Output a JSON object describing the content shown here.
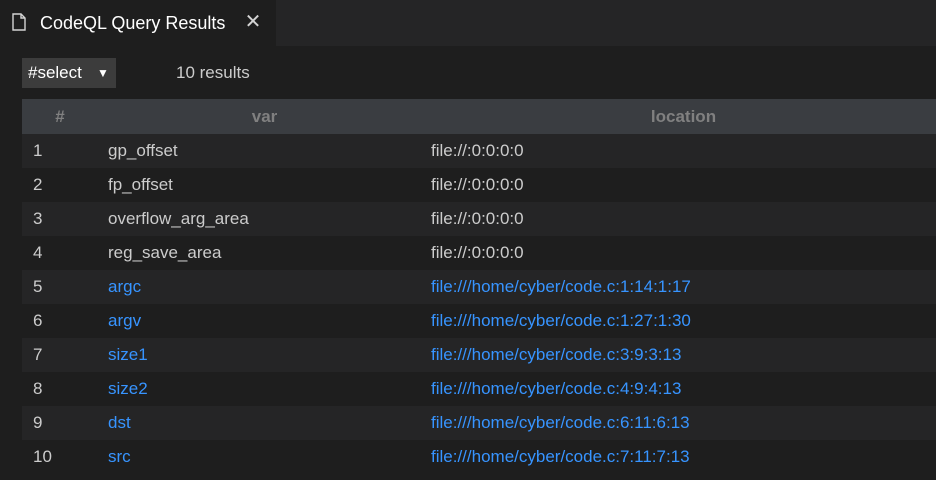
{
  "tab": {
    "title": "CodeQL Query Results",
    "icon": "file-icon",
    "close_icon": "close-icon",
    "close_glyph": "✕"
  },
  "toolbar": {
    "select_label": "#select",
    "select_caret": "▼",
    "result_count": "10 results"
  },
  "table": {
    "headers": [
      "#",
      "var",
      "location"
    ],
    "rows": [
      {
        "num": "1",
        "var": "gp_offset",
        "location": "file://:0:0:0:0",
        "linked": false
      },
      {
        "num": "2",
        "var": "fp_offset",
        "location": "file://:0:0:0:0",
        "linked": false
      },
      {
        "num": "3",
        "var": "overflow_arg_area",
        "location": "file://:0:0:0:0",
        "linked": false
      },
      {
        "num": "4",
        "var": "reg_save_area",
        "location": "file://:0:0:0:0",
        "linked": false
      },
      {
        "num": "5",
        "var": "argc",
        "location": "file:///home/cyber/code.c:1:14:1:17",
        "linked": true
      },
      {
        "num": "6",
        "var": "argv",
        "location": "file:///home/cyber/code.c:1:27:1:30",
        "linked": true
      },
      {
        "num": "7",
        "var": "size1",
        "location": "file:///home/cyber/code.c:3:9:3:13",
        "linked": true
      },
      {
        "num": "8",
        "var": "size2",
        "location": "file:///home/cyber/code.c:4:9:4:13",
        "linked": true
      },
      {
        "num": "9",
        "var": "dst",
        "location": "file:///home/cyber/code.c:6:11:6:13",
        "linked": true
      },
      {
        "num": "10",
        "var": "src",
        "location": "file:///home/cyber/code.c:7:11:7:13",
        "linked": true
      }
    ]
  },
  "colors": {
    "background": "#1e1e1e",
    "tabbar": "#252526",
    "header": "#3a3d41",
    "link": "#3794ff",
    "text": "#cccccc"
  }
}
